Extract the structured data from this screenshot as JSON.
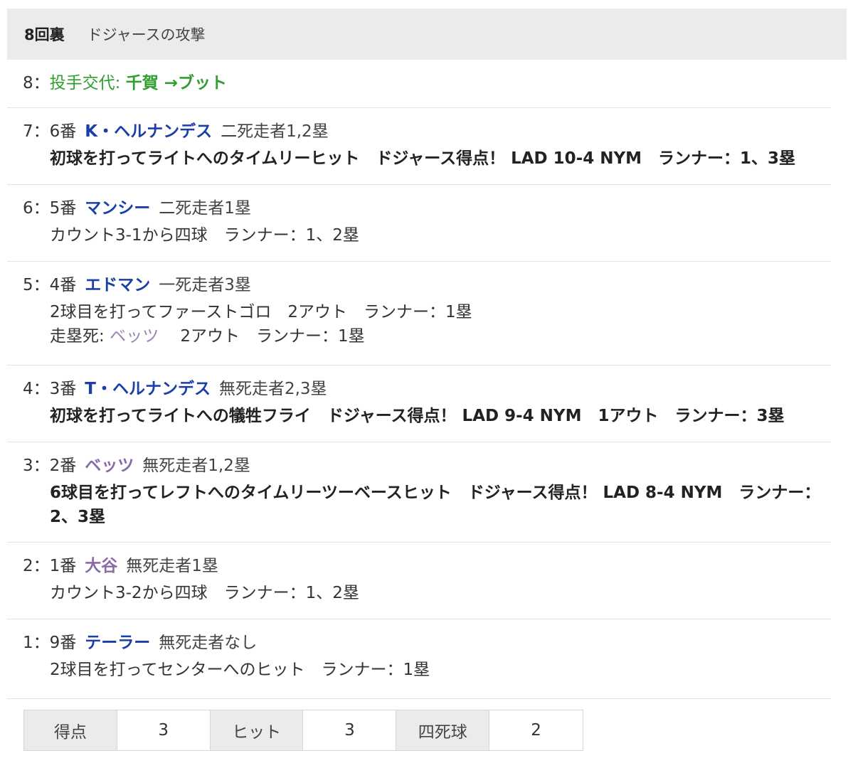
{
  "header": {
    "inning": "8回裏",
    "label": "ドジャースの攻撃"
  },
  "plays": [
    {
      "num": "8：",
      "pitch_change_label": "投手交代: ",
      "from": "千賀",
      "arrow_to": " →ブット"
    },
    {
      "num": "7：",
      "order": "6番",
      "batter": "K・ヘルナンデス",
      "situation": "二死走者1,2塁",
      "detail": "初球を打ってライトへのタイムリーヒット　ドジャース得点！ LAD 10-4 NYM　ランナー：1、3塁"
    },
    {
      "num": "6：",
      "order": "5番",
      "batter": "マンシー",
      "situation": "二死走者1塁",
      "detail": "カウント3-1から四球　ランナー：1、2塁"
    },
    {
      "num": "5：",
      "order": "4番",
      "batter": "エドマン",
      "situation": "一死走者3塁",
      "detail": "2球目を打ってファーストゴロ　2アウト　ランナー：1塁",
      "runner_out_label": "走塁死: ",
      "runner_out_name": "ベッツ",
      "runner_out_rest": "　 2アウト　ランナー：1塁"
    },
    {
      "num": "4：",
      "order": "3番",
      "batter": "T・ヘルナンデス",
      "situation": "無死走者2,3塁",
      "detail": "初球を打ってライトへの犠牲フライ　ドジャース得点！ LAD 9-4 NYM　1アウト　ランナー：3塁"
    },
    {
      "num": "3：",
      "order": "2番",
      "batter": "ベッツ",
      "situation": "無死走者1,2塁",
      "detail": "6球目を打ってレフトへのタイムリーツーベースヒット　ドジャース得点！ LAD 8-4 NYM　ランナー：2、3塁"
    },
    {
      "num": "2：",
      "order": "1番",
      "batter": "大谷",
      "situation": "無死走者1塁",
      "detail": "カウント3-2から四球　ランナー：1、2塁"
    },
    {
      "num": "1：",
      "order": "9番",
      "batter": "テーラー",
      "situation": "無死走者なし",
      "detail": "2球目を打ってセンターへのヒット　ランナー：1塁"
    }
  ],
  "summary": [
    {
      "label": "得点",
      "value": "3"
    },
    {
      "label": "ヒット",
      "value": "3"
    },
    {
      "label": "四死球",
      "value": "2"
    }
  ],
  "colors": {
    "batter_blue": "#1a3fa8",
    "batter_purple": "#8a6aa8",
    "pitch_change_green": "#2e9e2e"
  }
}
